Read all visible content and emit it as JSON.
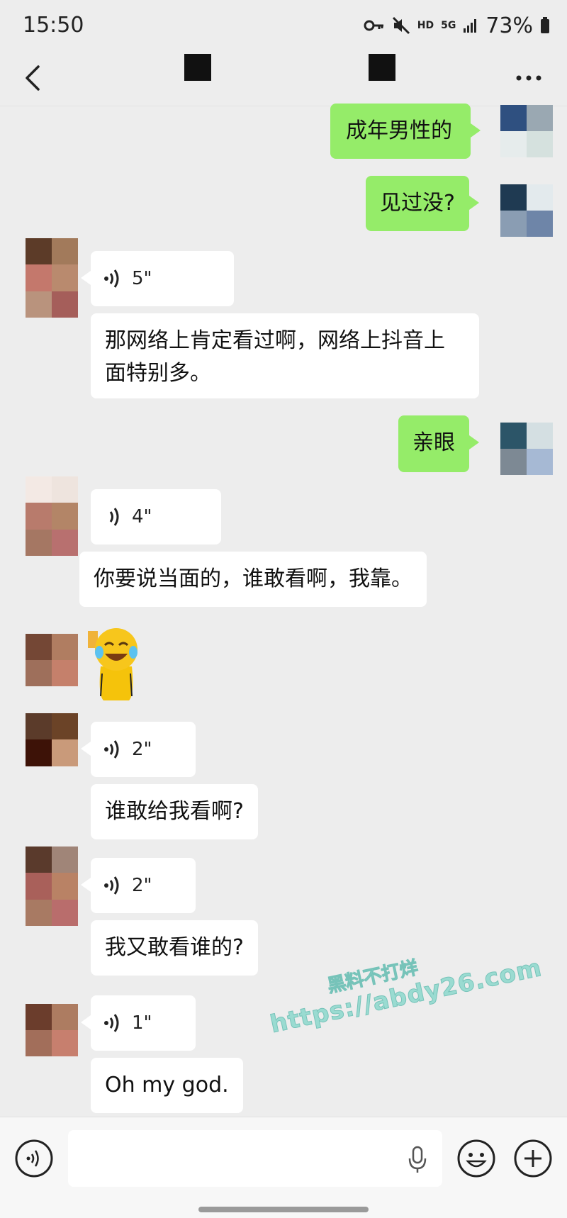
{
  "status_bar": {
    "time": "15:50",
    "network_hd": "HD",
    "network_5g": "5G",
    "battery": "73%"
  },
  "messages": [
    {
      "side": "me",
      "type": "text",
      "text": "成年男性的"
    },
    {
      "side": "me",
      "type": "text",
      "text": "见过没?"
    },
    {
      "side": "them",
      "type": "voice",
      "duration": "5\""
    },
    {
      "side": "them",
      "type": "text",
      "text": "那网络上肯定看过啊，网络上抖音上\n面特别多。"
    },
    {
      "side": "me",
      "type": "text",
      "text": "亲眼"
    },
    {
      "side": "them",
      "type": "voice",
      "duration": "4\""
    },
    {
      "side": "them",
      "type": "text",
      "text": "你要说当面的，谁敢看啊，我靠。"
    },
    {
      "side": "them",
      "type": "sticker",
      "icon": "laughing-tears-sticker"
    },
    {
      "side": "them",
      "type": "voice",
      "duration": "2\""
    },
    {
      "side": "them",
      "type": "text",
      "text": "谁敢给我看啊?"
    },
    {
      "side": "them",
      "type": "voice",
      "duration": "2\""
    },
    {
      "side": "them",
      "type": "text",
      "text": "我又敢看谁的?"
    },
    {
      "side": "them",
      "type": "voice",
      "duration": "1\""
    },
    {
      "side": "them",
      "type": "text",
      "text": "Oh my god."
    }
  ],
  "watermark": {
    "line1": "黑料不打烊",
    "line2": "https://abdy26.com"
  },
  "input_bar": {
    "value": "",
    "icons": [
      "voice-toggle-icon",
      "mic-icon",
      "emoji-icon",
      "plus-icon"
    ]
  },
  "colors": {
    "sent_bubble": "#95ec69",
    "received_bubble": "#ffffff",
    "background": "#ededed"
  }
}
